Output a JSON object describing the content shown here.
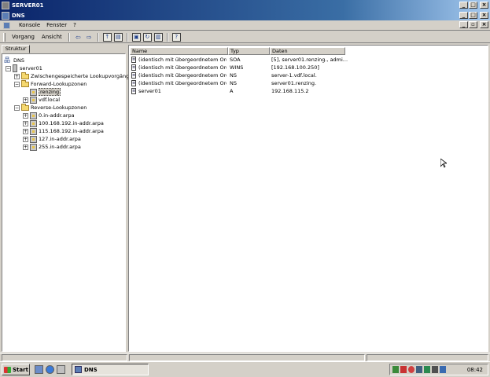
{
  "outer_window": {
    "title": "SERVER01"
  },
  "mmc_window": {
    "title": "DNS"
  },
  "menubar": {
    "items": [
      "Konsole",
      "Fenster",
      "?"
    ]
  },
  "toolbar": {
    "items": [
      "Vorgang",
      "Ansicht"
    ]
  },
  "left_pane": {
    "tab_label": "Struktur",
    "tree": {
      "root": "DNS",
      "server": "server01",
      "cache": "Zwischengespeicherte Lookupvorgänge",
      "forward": "Forward-Lookupzonen",
      "forward_zones": [
        "renzing",
        "vdf.local"
      ],
      "reverse": "Reverse-Lookupzonen",
      "reverse_zones": [
        "0.in-addr.arpa",
        "100.168.192.in-addr.arpa",
        "115.168.192.in-addr.arpa",
        "127.in-addr.arpa",
        "255.in-addr.arpa"
      ]
    }
  },
  "right_pane": {
    "columns": [
      "Name",
      "Typ",
      "Daten"
    ],
    "rows": [
      {
        "name": "(identisch mit übergeordnetem Ordn...",
        "type": "SOA",
        "data": "[5], server01.renzing., admi..."
      },
      {
        "name": "(identisch mit übergeordnetem Ordn...",
        "type": "WINS",
        "data": "[192.168.100.250]"
      },
      {
        "name": "(identisch mit übergeordnetem Ordn...",
        "type": "NS",
        "data": "server-1.vdf.local."
      },
      {
        "name": "(identisch mit übergeordnetem Ordn...",
        "type": "NS",
        "data": "server01.renzing."
      },
      {
        "name": "server01",
        "type": "A",
        "data": "192.168.115.2"
      }
    ]
  },
  "taskbar": {
    "start_label": "Start",
    "task_label": "DNS",
    "clock": "08:42"
  }
}
